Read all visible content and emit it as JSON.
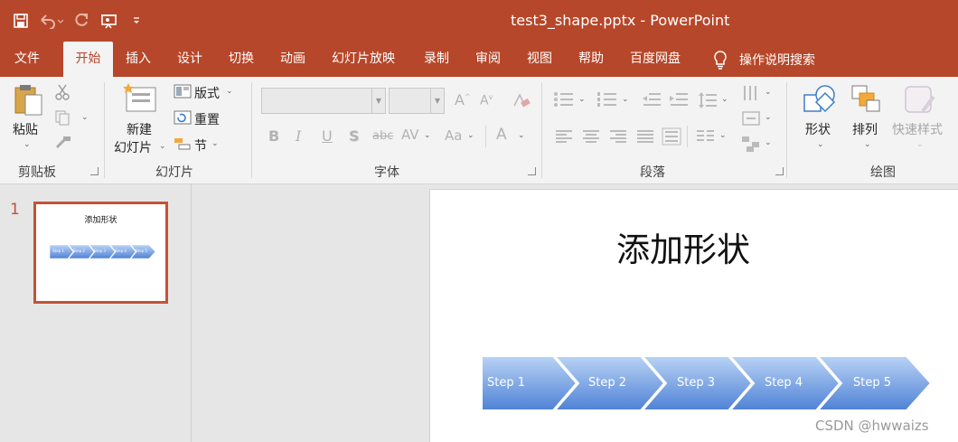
{
  "window": {
    "title": "test3_shape.pptx  -  PowerPoint",
    "colors": {
      "accent": "#b7472a",
      "slide_accent": "#c2533a",
      "chevron_top": "#b9d3f5",
      "chevron_bottom": "#4f82d6"
    }
  },
  "quick_access": {
    "icons": [
      "save-icon",
      "undo-icon",
      "redo-icon",
      "present-icon",
      "customize-icon"
    ]
  },
  "tabs": [
    "文件",
    "开始",
    "插入",
    "设计",
    "切换",
    "动画",
    "幻灯片放映",
    "录制",
    "审阅",
    "视图",
    "帮助",
    "百度网盘"
  ],
  "active_tab": "开始",
  "tell_me": {
    "label": "操作说明搜索",
    "icon": "lightbulb-icon"
  },
  "ribbon": {
    "clipboard": {
      "paste": "粘贴",
      "group": "剪贴板"
    },
    "slides": {
      "new_slide_line1": "新建",
      "new_slide_line2": "幻灯片",
      "layout": "版式",
      "reset": "重置",
      "section": "节",
      "group": "幻灯片"
    },
    "font": {
      "group": "字体",
      "buttons": [
        "B",
        "I",
        "U",
        "S",
        "abc",
        "AV",
        "Aa",
        "A"
      ]
    },
    "paragraph": {
      "group": "段落"
    },
    "drawing": {
      "shapes": "形状",
      "arrange": "排列",
      "quick_styles": "快速样式",
      "group": "绘图"
    }
  },
  "slides_pane": {
    "slide_number": "1",
    "thumb_title": "添加形状",
    "thumb_steps": [
      "Step 1",
      "Step 2",
      "Step 3",
      "Step 4",
      "Step 5"
    ]
  },
  "slide": {
    "title": "添加形状",
    "steps": [
      "Step 1",
      "Step 2",
      "Step 3",
      "Step 4",
      "Step 5"
    ]
  },
  "watermark": "CSDN @hwwaizs"
}
